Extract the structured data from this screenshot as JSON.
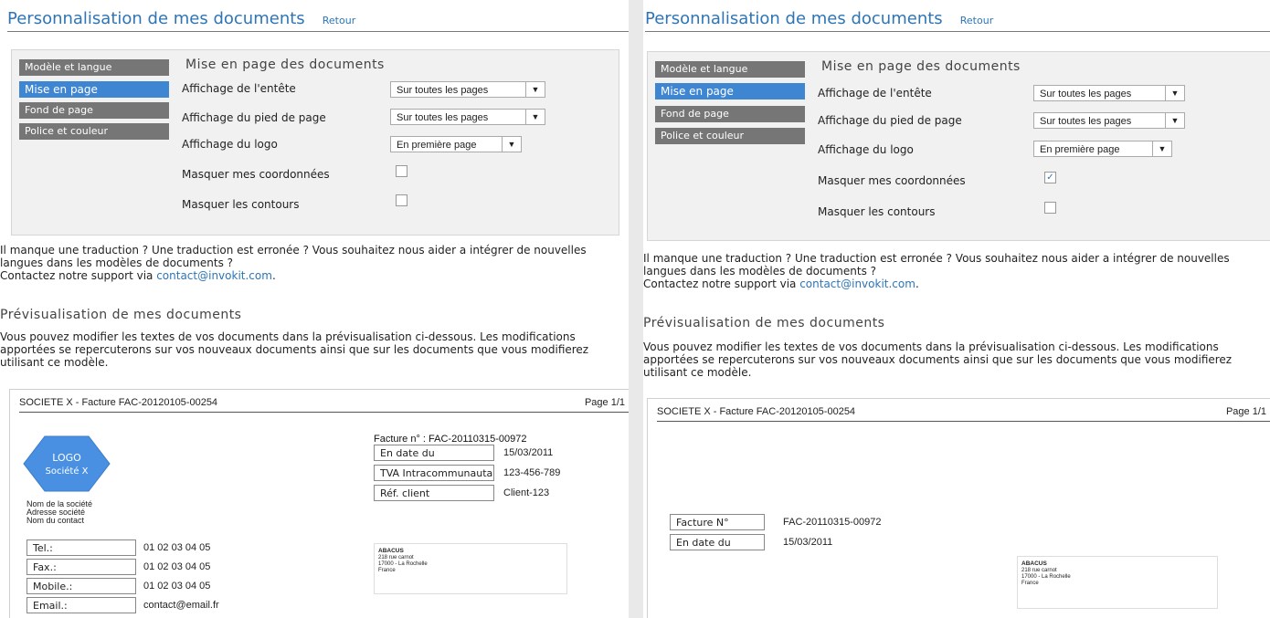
{
  "title": "Personnalisation de mes documents",
  "back_label": "Retour",
  "tabs": [
    {
      "label": "Modèle et langue"
    },
    {
      "label": "Mise en page"
    },
    {
      "label": "Fond de page"
    },
    {
      "label": "Police et couleur"
    }
  ],
  "active_tab": "Mise en page",
  "section_heading": "Mise en page des documents",
  "rows": {
    "header_label": "Affichage de l'entête",
    "footer_label": "Affichage du pied de page",
    "logo_label": "Affichage du logo",
    "hide_coords_label": "Masquer mes coordonnées",
    "hide_borders_label": "Masquer les contours"
  },
  "left_settings": {
    "header_value": "Sur toutes les pages",
    "footer_value": "Sur toutes les pages",
    "logo_value": "En première page",
    "hide_coords": false,
    "hide_borders": false
  },
  "right_settings": {
    "header_value": "Sur toutes les pages",
    "footer_value": "Sur toutes les pages",
    "logo_value": "En première page",
    "hide_coords": true,
    "hide_borders": false
  },
  "help_text": {
    "line1": "Il manque une traduction ? Une traduction est erronée ? Vous souhaitez nous aider a intégrer de nouvelles langues dans les modèles de documents ?",
    "contact_prefix": "Contactez notre support via ",
    "contact_email": "contact@invokit.com",
    "contact_suffix": "."
  },
  "preview_heading": "Prévisualisation de mes documents",
  "preview_text": "Vous pouvez modifier les textes de vos documents dans la prévisualisation ci-dessous. Les modifications apportées se repercuterons sur vos nouveaux documents ainsi que sur les documents que vous modifierez utilisant ce modèle.",
  "preview_left": {
    "doc_title": "SOCIETE X - Facture FAC-20120105-00254",
    "page": "Page 1/1",
    "invoice_line": "Facture n° : FAC-20110315-00972",
    "meta": [
      {
        "label": "En date du",
        "value": "15/03/2011"
      },
      {
        "label": "TVA Intracommunautaire",
        "value": "123-456-789"
      },
      {
        "label": "Réf. client",
        "value": "Client-123"
      }
    ],
    "logo_line1": "LOGO",
    "logo_line2": "Société X",
    "company": [
      "Nom de la société",
      "Adresse société",
      "Nom du contact"
    ],
    "contacts": [
      {
        "label": "Tel.:",
        "value": "01 02 03 04 05"
      },
      {
        "label": "Fax.:",
        "value": "01 02 03 04 05"
      },
      {
        "label": "Mobile.:",
        "value": "01 02 03 04 05"
      },
      {
        "label": "Email.:",
        "value": "contact@email.fr"
      }
    ],
    "address": {
      "name": "ABACUS",
      "lines": [
        "218 rue carnot",
        "17000 - La Rochelle",
        "France"
      ]
    }
  },
  "preview_right": {
    "doc_title": "SOCIETE X - Facture FAC-20120105-00254",
    "page": "Page 1/1",
    "meta": [
      {
        "label": "Facture N°",
        "value": "FAC-20110315-00972"
      },
      {
        "label": "En date du",
        "value": "15/03/2011"
      }
    ],
    "address": {
      "name": "ABACUS",
      "lines": [
        "218 rue carnot",
        "17000 - La Rochelle",
        "France"
      ]
    }
  },
  "colors": {
    "accent": "#2e75b6",
    "tab_active": "#3f86d2",
    "tab": "#767676",
    "logo": "#4a90e2"
  },
  "icons": {
    "dropdown": "chevron-down-icon",
    "checkbox": "checkbox-icon",
    "logo": "hexagon-logo"
  }
}
